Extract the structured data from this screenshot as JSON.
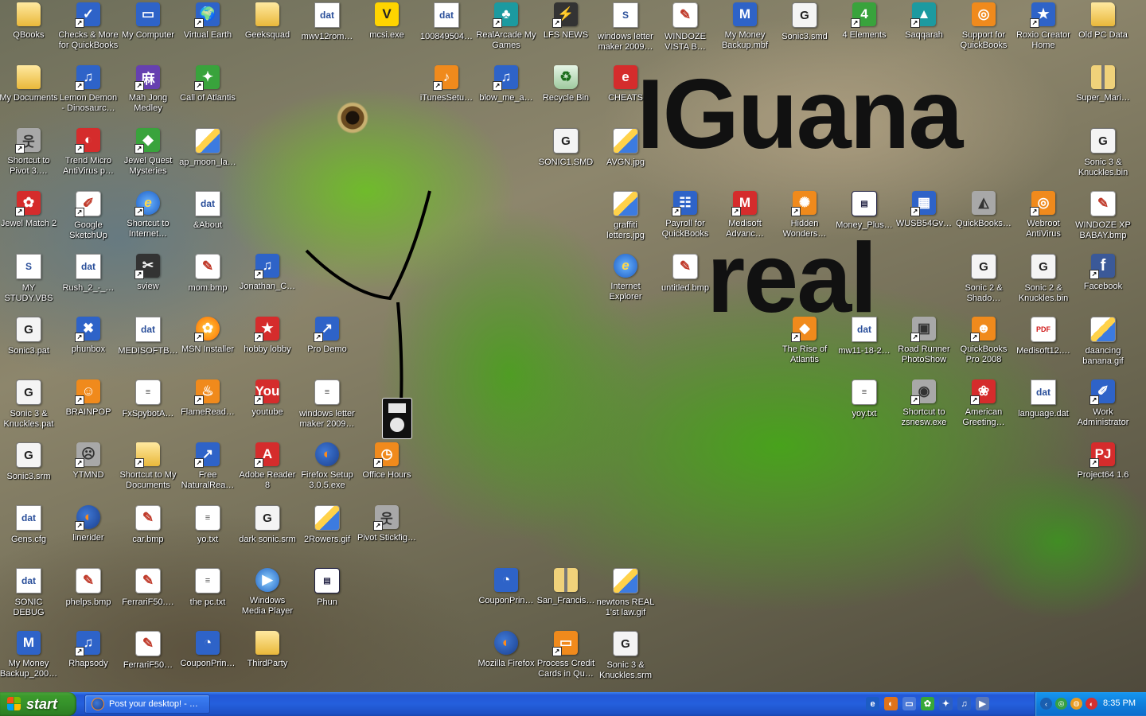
{
  "wallpaper": {
    "title_line_1": "IGuana",
    "title_line_2": "real"
  },
  "icons": [
    {
      "label": "QBooks",
      "type": "folder",
      "glyph": ""
    },
    {
      "label": "Checks & More for QuickBooks",
      "type": "blue",
      "glyph": "✓",
      "shortcut": true
    },
    {
      "label": "My Computer",
      "type": "blue",
      "glyph": "▭"
    },
    {
      "label": "Virtual Earth",
      "type": "blue",
      "glyph": "🌍",
      "shortcut": true
    },
    {
      "label": "Geeksquad",
      "type": "folder",
      "glyph": ""
    },
    {
      "label": "mwv12rom…",
      "type": "doc",
      "glyph": "dat"
    },
    {
      "label": "mcsi.exe",
      "type": "yellow",
      "glyph": "V"
    },
    {
      "label": "100849504…",
      "type": "doc",
      "glyph": "dat"
    },
    {
      "label": "RealArcade My Games",
      "type": "teal",
      "glyph": "♣",
      "shortcut": true
    },
    {
      "label": "LFS NEWS",
      "type": "dark",
      "glyph": "⚡",
      "shortcut": true
    },
    {
      "label": "windows letter maker 2009…",
      "type": "doc",
      "glyph": "S"
    },
    {
      "label": "WINDOZE VISTA B…",
      "type": "paint",
      "glyph": "✎"
    },
    {
      "label": "My Money Backup.mbf",
      "type": "blue",
      "glyph": "M"
    },
    {
      "label": "Sonic3.smd",
      "type": "sega",
      "glyph": "G"
    },
    {
      "label": "4 Elements",
      "type": "green",
      "glyph": "4",
      "shortcut": true
    },
    {
      "label": "Saqqarah",
      "type": "teal",
      "glyph": "▲",
      "shortcut": true
    },
    {
      "label": "Support for QuickBooks",
      "type": "orange",
      "glyph": "◎"
    },
    {
      "label": "Roxio Creator Home",
      "type": "blue",
      "glyph": "★",
      "shortcut": true
    },
    {
      "label": "Old PC Data",
      "type": "folder",
      "glyph": ""
    },
    {
      "label": "My Documents",
      "type": "folder",
      "glyph": ""
    },
    {
      "label": "Lemon Demon - Dinosaurc…",
      "type": "blue",
      "glyph": "♫",
      "shortcut": true
    },
    {
      "label": "Mah Jong Medley",
      "type": "purple",
      "glyph": "麻",
      "shortcut": true
    },
    {
      "label": "Call of Atlantis",
      "type": "green",
      "glyph": "✦",
      "shortcut": true
    },
    {
      "label": "iTunesSetu…",
      "type": "orange",
      "glyph": "♪",
      "shortcut": true
    },
    {
      "label": "blow_me_a…",
      "type": "blue",
      "glyph": "♫",
      "shortcut": true
    },
    {
      "label": "Recycle Bin",
      "type": "recycle",
      "glyph": "♻"
    },
    {
      "label": "CHEATS",
      "type": "red",
      "glyph": "e"
    },
    {
      "label": "Super_Mari…",
      "type": "zip",
      "glyph": ""
    },
    {
      "label": "Shortcut to Pivot 3.…",
      "type": "gray",
      "glyph": "웃",
      "shortcut": true
    },
    {
      "label": "Trend Micro AntiVirus p…",
      "type": "red",
      "glyph": "◐",
      "shortcut": true
    },
    {
      "label": "Jewel Quest Mysteries",
      "type": "green",
      "glyph": "◆",
      "shortcut": true
    },
    {
      "label": "ap_moon_la…",
      "type": "image",
      "glyph": ""
    },
    {
      "label": "SONIC1.SMD",
      "type": "sega",
      "glyph": "G"
    },
    {
      "label": "AVGN.jpg",
      "type": "image",
      "glyph": ""
    },
    {
      "label": "Sonic 3 & Knuckles.bin",
      "type": "sega",
      "glyph": "G"
    },
    {
      "label": "Jewel Match 2",
      "type": "red",
      "glyph": "✿",
      "shortcut": true
    },
    {
      "label": "Google SketchUp",
      "type": "paint",
      "glyph": "✐",
      "shortcut": true
    },
    {
      "label": "Shortcut to Internet…",
      "type": "ie",
      "glyph": "e",
      "shortcut": true
    },
    {
      "label": "&About",
      "type": "doc",
      "glyph": "dat"
    },
    {
      "label": "graffiti letters.jpg",
      "type": "image",
      "glyph": ""
    },
    {
      "label": "Payroll for QuickBooks",
      "type": "blue",
      "glyph": "☷",
      "shortcut": true
    },
    {
      "label": "Medisoft Advanc…",
      "type": "red",
      "glyph": "M",
      "shortcut": true
    },
    {
      "label": "Hidden Wonders…",
      "type": "orange",
      "glyph": "✺",
      "shortcut": true
    },
    {
      "label": "Money_Plus…",
      "type": "window",
      "glyph": "▤"
    },
    {
      "label": "WUSB54Gv…",
      "type": "blue",
      "glyph": "▦",
      "shortcut": true
    },
    {
      "label": "QuickBooks…",
      "type": "gray",
      "glyph": "◭"
    },
    {
      "label": "Webroot AntiVirus",
      "type": "orange",
      "glyph": "◎",
      "shortcut": true
    },
    {
      "label": "WINDOZE XP BABAY.bmp",
      "type": "paint",
      "glyph": "✎"
    },
    {
      "label": "MY STUDY.VBS",
      "type": "doc",
      "glyph": "S"
    },
    {
      "label": "Rush_2_-_…",
      "type": "doc",
      "glyph": "dat"
    },
    {
      "label": "sview",
      "type": "dark",
      "glyph": "✂",
      "shortcut": true
    },
    {
      "label": "mom.bmp",
      "type": "paint",
      "glyph": "✎"
    },
    {
      "label": "Jonathan_C…",
      "type": "blue",
      "glyph": "♫",
      "shortcut": true
    },
    {
      "label": "Internet Explorer",
      "type": "ie",
      "glyph": "e"
    },
    {
      "label": "untitled.bmp",
      "type": "paint",
      "glyph": "✎"
    },
    {
      "label": "Sonic 2 & Shado…",
      "type": "sega",
      "glyph": "G"
    },
    {
      "label": "Sonic 2 & Knuckles.bin",
      "type": "sega",
      "glyph": "G"
    },
    {
      "label": "Facebook",
      "type": "fb",
      "glyph": "f",
      "shortcut": true
    },
    {
      "label": "Sonic3.pat",
      "type": "sega",
      "glyph": "G"
    },
    {
      "label": "phunbox",
      "type": "blue",
      "glyph": "✖",
      "shortcut": true
    },
    {
      "label": "MEDISOFTB…",
      "type": "doc",
      "glyph": "dat"
    },
    {
      "label": "MSN Installer",
      "type": "msn",
      "glyph": "✿",
      "shortcut": true
    },
    {
      "label": "hobby lobby",
      "type": "red",
      "glyph": "★",
      "shortcut": true
    },
    {
      "label": "Pro Demo",
      "type": "blue",
      "glyph": "↗",
      "shortcut": true
    },
    {
      "label": "The Rise of Atlantis",
      "type": "orange",
      "glyph": "◆",
      "shortcut": true
    },
    {
      "label": "mw11-18-2…",
      "type": "doc",
      "glyph": "dat"
    },
    {
      "label": "Road Runner PhotoShow",
      "type": "gray",
      "glyph": "▣",
      "shortcut": true
    },
    {
      "label": "QuickBooks Pro 2008",
      "type": "orange",
      "glyph": "☻",
      "shortcut": true
    },
    {
      "label": "Medisoft12.…",
      "type": "pdf",
      "glyph": "PDF"
    },
    {
      "label": "daancing banana.gif",
      "type": "image",
      "glyph": ""
    },
    {
      "label": "Sonic 3 & Knuckles.pat",
      "type": "sega",
      "glyph": "G"
    },
    {
      "label": "BRAINPOP",
      "type": "orange",
      "glyph": "☺",
      "shortcut": true
    },
    {
      "label": "FxSpybotA…",
      "type": "txt",
      "glyph": "≡"
    },
    {
      "label": "FlameRead…",
      "type": "orange",
      "glyph": "♨",
      "shortcut": true
    },
    {
      "label": "youtube",
      "type": "red",
      "glyph": "You",
      "shortcut": true
    },
    {
      "label": "windows letter maker 2009…",
      "type": "txt",
      "glyph": "≡"
    },
    {
      "label": "yoy.txt",
      "type": "txt",
      "glyph": "≡"
    },
    {
      "label": "Shortcut to zsnesw.exe",
      "type": "gray",
      "glyph": "◉",
      "shortcut": true
    },
    {
      "label": "American Greeting…",
      "type": "red",
      "glyph": "❀",
      "shortcut": true
    },
    {
      "label": "language.dat",
      "type": "doc",
      "glyph": "dat"
    },
    {
      "label": "Work Administrator",
      "type": "blue",
      "glyph": "✐",
      "shortcut": true
    },
    {
      "label": "Sonic3.srm",
      "type": "sega",
      "glyph": "G"
    },
    {
      "label": "YTMND",
      "type": "gray",
      "glyph": "☹",
      "shortcut": true
    },
    {
      "label": "Shortcut to My Documents",
      "type": "folder",
      "glyph": "",
      "shortcut": true
    },
    {
      "label": "Free NaturalRea…",
      "type": "blue",
      "glyph": "↗",
      "shortcut": true
    },
    {
      "label": "Adobe Reader 8",
      "type": "red",
      "glyph": "A",
      "shortcut": true
    },
    {
      "label": "Firefox Setup 3.0.5.exe",
      "type": "fx",
      "glyph": "◐"
    },
    {
      "label": "Office Hours",
      "type": "orange",
      "glyph": "◷",
      "shortcut": true
    },
    {
      "label": "Project64 1.6",
      "type": "red",
      "glyph": "PJ",
      "shortcut": true
    },
    {
      "label": "Gens.cfg",
      "type": "doc",
      "glyph": "dat"
    },
    {
      "label": "linerider",
      "type": "fx",
      "glyph": "◐",
      "shortcut": true
    },
    {
      "label": "car.bmp",
      "type": "paint",
      "glyph": "✎"
    },
    {
      "label": "yo.txt",
      "type": "txt",
      "glyph": "≡"
    },
    {
      "label": "dark sonic.srm",
      "type": "sega",
      "glyph": "G"
    },
    {
      "label": "2Rowers.gif",
      "type": "image",
      "glyph": ""
    },
    {
      "label": "Pivot Stickfig…",
      "type": "gray",
      "glyph": "웃",
      "shortcut": true
    },
    {
      "label": "SONIC DEBUG",
      "type": "doc",
      "glyph": "dat"
    },
    {
      "label": "phelps.bmp",
      "type": "paint",
      "glyph": "✎"
    },
    {
      "label": "FerrariF50.…",
      "type": "paint",
      "glyph": "✎"
    },
    {
      "label": "the pc.txt",
      "type": "txt",
      "glyph": "≡"
    },
    {
      "label": "Windows Media Player",
      "type": "media",
      "glyph": "▶"
    },
    {
      "label": "Phun",
      "type": "window",
      "glyph": "▤"
    },
    {
      "label": "CouponPrin…",
      "type": "blue",
      "glyph": "◔"
    },
    {
      "label": "San_Francis…",
      "type": "zip",
      "glyph": ""
    },
    {
      "label": "newtons REAL 1'st law.gif",
      "type": "image",
      "glyph": ""
    },
    {
      "label": "My Money Backup_200…",
      "type": "blue",
      "glyph": "M"
    },
    {
      "label": "Rhapsody",
      "type": "blue",
      "glyph": "♫",
      "shortcut": true
    },
    {
      "label": "FerrariF50…",
      "type": "paint",
      "glyph": "✎"
    },
    {
      "label": "CouponPrin…",
      "type": "blue",
      "glyph": "◔"
    },
    {
      "label": "ThirdParty",
      "type": "folder",
      "glyph": ""
    },
    {
      "label": "Mozilla Firefox",
      "type": "fx",
      "glyph": "◐"
    },
    {
      "label": "Process Credit Cards in Qu…",
      "type": "orange",
      "glyph": "▭",
      "shortcut": true
    },
    {
      "label": "Sonic 3 & Knuckles.srm",
      "type": "sega",
      "glyph": "G"
    }
  ],
  "taskbar": {
    "start_label": "start",
    "task_label": "Post your desktop! - …",
    "quick_launch": [
      {
        "name": "internet-explorer",
        "glyph": "e",
        "color": "#1c5cc4"
      },
      {
        "name": "firefox",
        "glyph": "◐",
        "color": "#e0731a"
      },
      {
        "name": "show-desktop",
        "glyph": "▭",
        "color": "#4c7ad8"
      },
      {
        "name": "messenger",
        "glyph": "✿",
        "color": "#38a838"
      },
      {
        "name": "pivot",
        "glyph": "✦",
        "color": "#2d5fc0"
      },
      {
        "name": "media",
        "glyph": "♫",
        "color": "#2d5fc0"
      },
      {
        "name": "player",
        "glyph": "▶",
        "color": "#5a78b8"
      }
    ],
    "tray": [
      {
        "name": "tray-chevron",
        "glyph": "‹",
        "color": "#1a5fb0"
      },
      {
        "name": "tray-network",
        "glyph": "◎",
        "color": "#35a045"
      },
      {
        "name": "tray-globe",
        "glyph": "◍",
        "color": "#e89a20"
      },
      {
        "name": "tray-antivirus",
        "glyph": "◐",
        "color": "#d43030"
      }
    ],
    "clock": "8:35 PM"
  }
}
